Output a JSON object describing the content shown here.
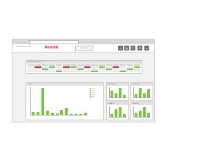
{
  "header": {
    "app_title": "Rexroth ActiveCockpit",
    "logo": "Rexroth",
    "button_label": "Overview",
    "toolbar_icons": [
      "home-icon",
      "chart-icon",
      "search-icon",
      "settings-icon",
      "menu-icon"
    ]
  },
  "panels": {
    "table_title": "Production overview",
    "main_chart_title": "Output",
    "legend": [
      "Line 1",
      "Line 2",
      "Line 3",
      "Line 4",
      "Line 5"
    ],
    "mini_titles": [
      "Station A",
      "Station B",
      "Station C",
      "Station D"
    ]
  },
  "chart_data": [
    {
      "type": "bar",
      "values": [
        4,
        4,
        35,
        5,
        3,
        2,
        6,
        9,
        1,
        1,
        1,
        3
      ]
    },
    {
      "type": "bar",
      "values": [
        8,
        5,
        11,
        3
      ]
    },
    {
      "type": "bar",
      "values": [
        4,
        12,
        5,
        10
      ]
    },
    {
      "type": "bar",
      "values": [
        4,
        10,
        13,
        4
      ]
    },
    {
      "type": "bar",
      "values": [
        5,
        8,
        12,
        5
      ]
    }
  ],
  "colors": {
    "accent": "#7cc243",
    "brand": "#e2001a",
    "alert": "#e0202c"
  }
}
